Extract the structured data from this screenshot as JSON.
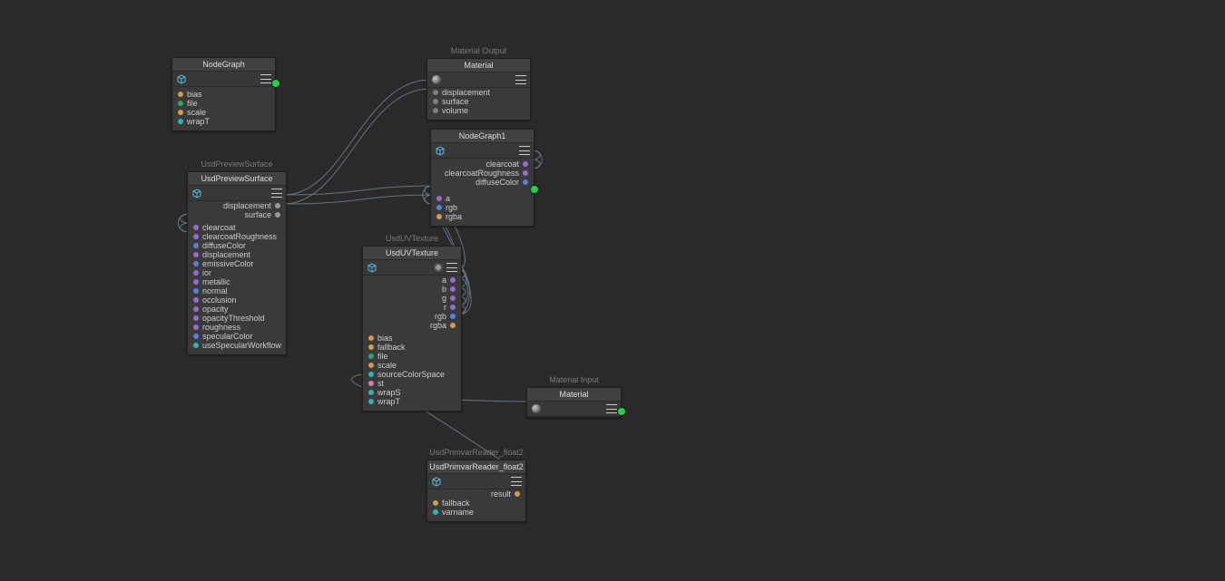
{
  "nodes": {
    "nodegraph": {
      "title": "NodeGraph",
      "supertitle": "",
      "inputs": [
        {
          "label": "bias",
          "color": "c-orange"
        },
        {
          "label": "file",
          "color": "c-green"
        },
        {
          "label": "scale",
          "color": "c-orange"
        },
        {
          "label": "wrapT",
          "color": "c-teal"
        }
      ],
      "outputs": []
    },
    "previewsurface": {
      "title": "UsdPreviewSurface",
      "supertitle": "UsdPreviewSurface",
      "outputs": [
        {
          "label": "displacement",
          "color": "c-ltgray"
        },
        {
          "label": "surface",
          "color": "c-ltgray"
        }
      ],
      "inputs": [
        {
          "label": "clearcoat",
          "color": "c-purple"
        },
        {
          "label": "clearcoatRoughness",
          "color": "c-purple"
        },
        {
          "label": "diffuseColor",
          "color": "c-blue"
        },
        {
          "label": "displacement",
          "color": "c-purple"
        },
        {
          "label": "emissiveColor",
          "color": "c-blue"
        },
        {
          "label": "ior",
          "color": "c-purple"
        },
        {
          "label": "metallic",
          "color": "c-purple"
        },
        {
          "label": "normal",
          "color": "c-blue"
        },
        {
          "label": "occlusion",
          "color": "c-purple"
        },
        {
          "label": "opacity",
          "color": "c-purple"
        },
        {
          "label": "opacityThreshold",
          "color": "c-purple"
        },
        {
          "label": "roughness",
          "color": "c-purple"
        },
        {
          "label": "specularColor",
          "color": "c-blue"
        },
        {
          "label": "useSpecularWorkflow",
          "color": "c-teal"
        }
      ]
    },
    "materialout": {
      "title": "Material",
      "supertitle": "Material Output",
      "inputs": [
        {
          "label": "displacement",
          "color": "c-gray"
        },
        {
          "label": "surface",
          "color": "c-gray"
        },
        {
          "label": "volume",
          "color": "c-gray"
        }
      ]
    },
    "nodegraph1": {
      "title": "NodeGraph1",
      "supertitle": "",
      "outRight": [
        {
          "label": "clearcoat",
          "color": "c-purple"
        },
        {
          "label": "clearcoatRoughness",
          "color": "c-purple"
        },
        {
          "label": "diffuseColor",
          "color": "c-blue"
        }
      ],
      "inLeft": [
        {
          "label": "a",
          "color": "c-purple"
        },
        {
          "label": "rgb",
          "color": "c-blue"
        },
        {
          "label": "rgba",
          "color": "c-orange"
        }
      ]
    },
    "uvtex": {
      "title": "UsdUVTexture",
      "supertitle": "UsdUVTexture",
      "outputs": [
        {
          "label": "a",
          "color": "c-purple"
        },
        {
          "label": "b",
          "color": "c-purple"
        },
        {
          "label": "g",
          "color": "c-purple"
        },
        {
          "label": "r",
          "color": "c-purple"
        },
        {
          "label": "rgb",
          "color": "c-blue"
        },
        {
          "label": "rgba",
          "color": "c-orange"
        }
      ],
      "inputs": [
        {
          "label": "bias",
          "color": "c-orange"
        },
        {
          "label": "fallback",
          "color": "c-orange"
        },
        {
          "label": "file",
          "color": "c-green"
        },
        {
          "label": "scale",
          "color": "c-orange"
        },
        {
          "label": "sourceColorSpace",
          "color": "c-teal"
        },
        {
          "label": "st",
          "color": "c-pink"
        },
        {
          "label": "wrapS",
          "color": "c-teal"
        },
        {
          "label": "wrapT",
          "color": "c-teal"
        }
      ]
    },
    "materialin": {
      "title": "Material",
      "supertitle": "Material Input"
    },
    "primvar": {
      "title": "UsdPrimvarReader_float2",
      "supertitle": "UsdPrimvarReader_float2",
      "outputs": [
        {
          "label": "result",
          "color": "c-orange"
        }
      ],
      "inputs": [
        {
          "label": "fallback",
          "color": "c-orange"
        },
        {
          "label": "varname",
          "color": "c-teal"
        }
      ]
    }
  }
}
